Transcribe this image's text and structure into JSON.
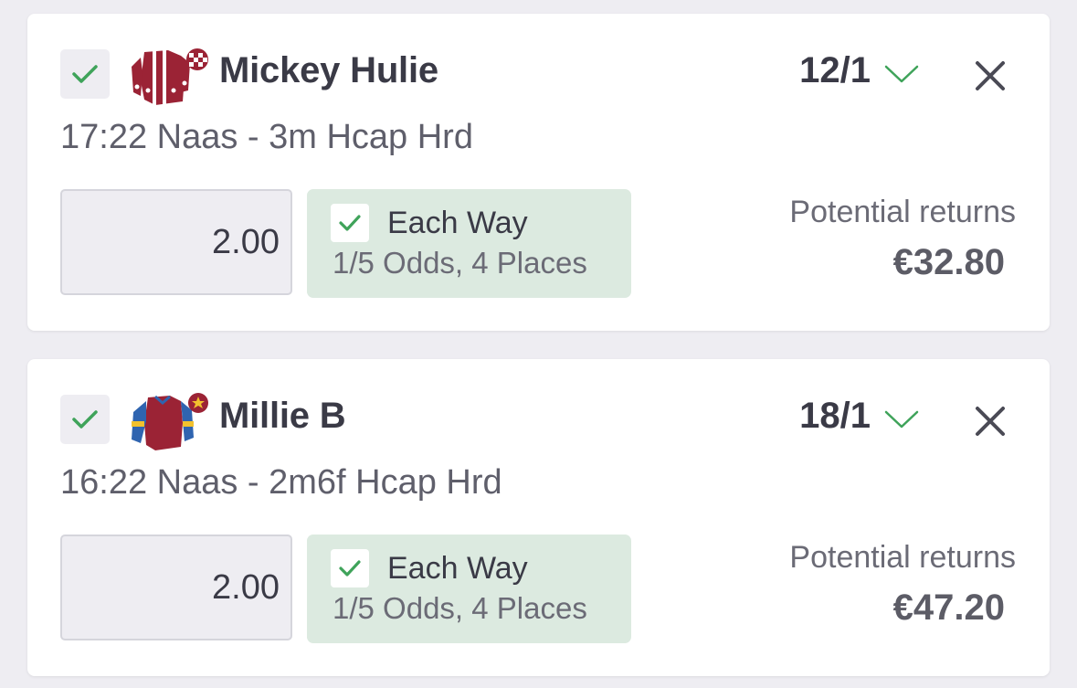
{
  "colors": {
    "page_bg": "#eeedf2",
    "card_bg": "#ffffff",
    "accent_green": "#3fa35a",
    "each_way_bg": "#dceae0"
  },
  "bets": [
    {
      "runner": "Mickey Hulie",
      "odds": "12/1",
      "race": "17:22 Naas - 3m Hcap Hrd",
      "stake": "2.00",
      "each_way_label": "Each Way",
      "each_way_terms": "1/5 Odds, 4 Places",
      "returns_label": "Potential returns",
      "returns_value": "€32.80",
      "selected": true,
      "each_way_checked": true,
      "silk_icon": "maroon-white-striped-jockey-silk",
      "icons": {
        "check": "check-icon",
        "odds_toggle": "chevron-down-icon",
        "remove": "close-icon"
      }
    },
    {
      "runner": "Millie B",
      "odds": "18/1",
      "race": "16:22 Naas - 2m6f Hcap Hrd",
      "stake": "2.00",
      "each_way_label": "Each Way",
      "each_way_terms": "1/5 Odds, 4 Places",
      "returns_label": "Potential returns",
      "returns_value": "€47.20",
      "selected": true,
      "each_way_checked": true,
      "silk_icon": "maroon-blue-sleeves-jockey-silk",
      "icons": {
        "check": "check-icon",
        "odds_toggle": "chevron-down-icon",
        "remove": "close-icon"
      }
    }
  ]
}
